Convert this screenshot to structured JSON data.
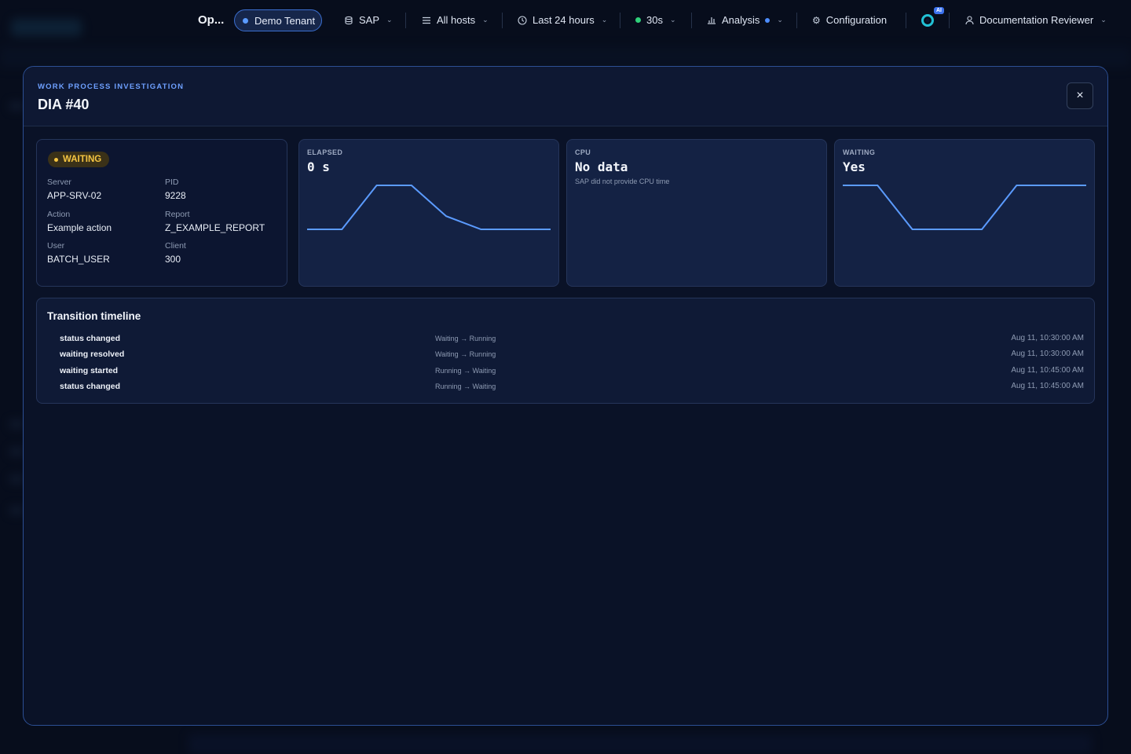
{
  "nav": {
    "title": "Op...",
    "tenant": "Demo Tenant",
    "sap": "SAP",
    "hosts": "All hosts",
    "time_range": "Last 24 hours",
    "refresh": "30s",
    "analysis": "Analysis",
    "configuration": "Configuration",
    "ai_badge": "AI",
    "user": "Documentation Reviewer"
  },
  "modal": {
    "eyebrow": "WORK PROCESS INVESTIGATION",
    "title": "DIA #40",
    "close": "×"
  },
  "info": {
    "status": "WAITING",
    "fields": [
      {
        "label": "Server",
        "value": "APP-SRV-02"
      },
      {
        "label": "PID",
        "value": "9228"
      },
      {
        "label": "Action",
        "value": "Example action"
      },
      {
        "label": "Report",
        "value": "Z_EXAMPLE_REPORT"
      },
      {
        "label": "User",
        "value": "BATCH_USER"
      },
      {
        "label": "Client",
        "value": "300"
      }
    ]
  },
  "metrics": {
    "elapsed": {
      "label": "ELAPSED",
      "value": "0 s",
      "series": [
        0,
        0,
        1,
        1,
        0.3,
        0,
        0,
        0
      ]
    },
    "cpu": {
      "label": "CPU",
      "value": "No data",
      "note": "SAP did not provide CPU time"
    },
    "waiting": {
      "label": "WAITING",
      "value": "Yes",
      "series": [
        1,
        1,
        0,
        0,
        0,
        1,
        1,
        1
      ]
    }
  },
  "timeline": {
    "title": "Transition timeline",
    "rows": [
      {
        "event": "status changed",
        "transition": "Waiting → Running",
        "time": "Aug 11, 10:30:00 AM"
      },
      {
        "event": "waiting resolved",
        "transition": "Waiting → Running",
        "time": "Aug 11, 10:30:00 AM"
      },
      {
        "event": "waiting started",
        "transition": "Running → Waiting",
        "time": "Aug 11, 10:45:00 AM"
      },
      {
        "event": "status changed",
        "transition": "Running → Waiting",
        "time": "Aug 11, 10:45:00 AM"
      }
    ]
  },
  "colors": {
    "accent": "#5b9bff",
    "waiting": "#f5c542",
    "live": "#2fd07a"
  }
}
